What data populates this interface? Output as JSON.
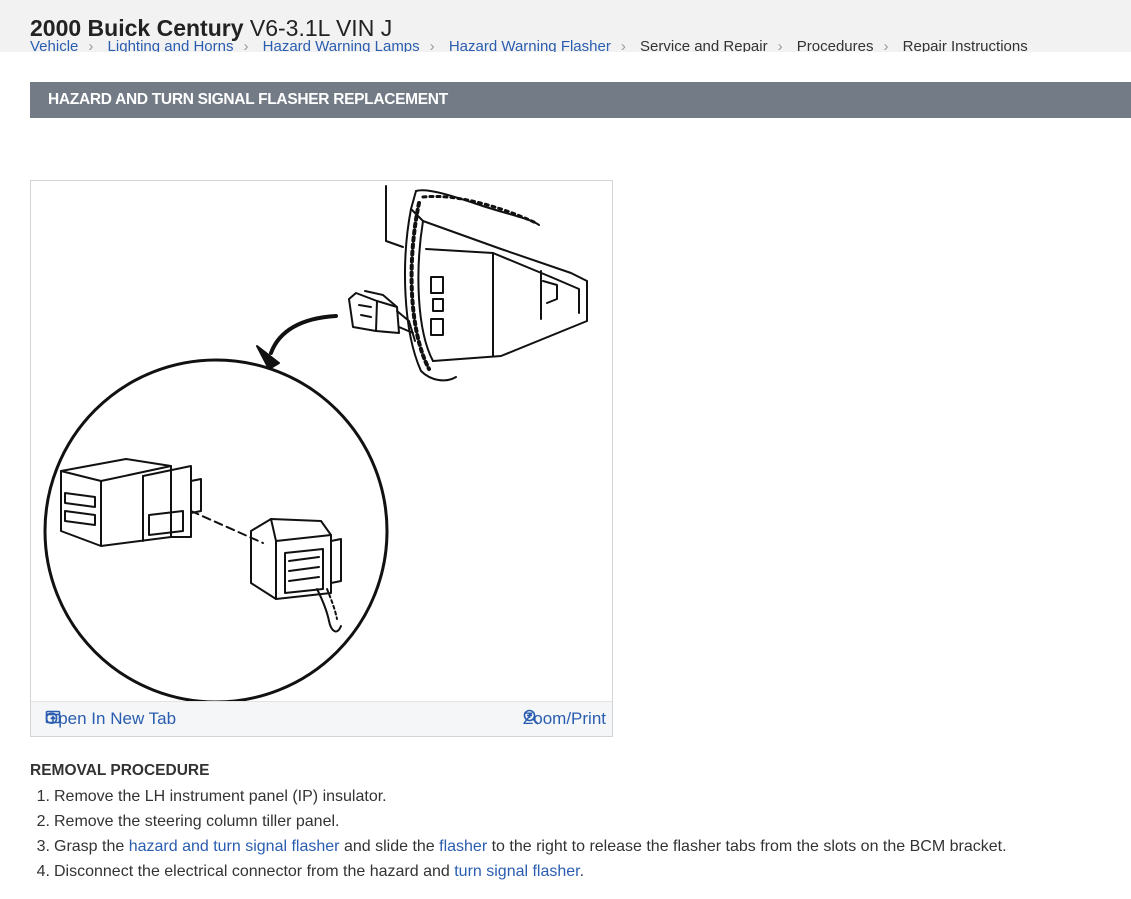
{
  "header": {
    "vehicle_make": "2000 Buick Century",
    "vehicle_engine": "V6-3.1L VIN J",
    "breadcrumbs": [
      "Vehicle",
      "Lighting and Horns",
      "Hazard Warning Lamps",
      "Hazard Warning Flasher",
      "Service and Repair",
      "Procedures",
      "Repair Instructions"
    ]
  },
  "section": {
    "title": "HAZARD AND TURN SIGNAL FLASHER REPLACEMENT"
  },
  "figure": {
    "open_label": "Open In New Tab",
    "zoom_label": "Zoom/Print",
    "open_icon": "open-in-new-tab-icon",
    "zoom_icon": "zoom-in-icon"
  },
  "procedure": {
    "title": "REMOVAL PROCEDURE",
    "steps": [
      {
        "num": "1.",
        "parts": [
          {
            "t": "Remove the LH instrument panel (IP) insulator."
          }
        ]
      },
      {
        "num": "2.",
        "parts": [
          {
            "t": "Remove the steering column tiller panel."
          }
        ]
      },
      {
        "num": "3.",
        "parts": [
          {
            "t": "Grasp the "
          },
          {
            "t": "hazard and turn signal flasher",
            "link": true
          },
          {
            "t": " and slide the "
          },
          {
            "t": "flasher",
            "link": true
          },
          {
            "t": " to the right to release the flasher tabs from the slots on the BCM bracket."
          }
        ]
      },
      {
        "num": "4.",
        "parts": [
          {
            "t": "Disconnect the electrical connector from the hazard and "
          },
          {
            "t": "turn signal flasher",
            "link": true
          },
          {
            "t": "."
          }
        ]
      }
    ]
  },
  "colors": {
    "header_bar": "#727b86",
    "link": "#2a5db0",
    "topbar": "#f2f2f2"
  }
}
